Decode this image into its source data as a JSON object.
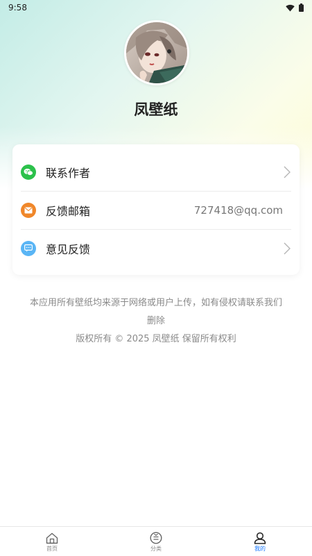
{
  "status_bar": {
    "time": "9:58"
  },
  "profile": {
    "app_name": "凤壁纸"
  },
  "menu": {
    "items": [
      {
        "label": "联系作者",
        "icon": "wechat-icon",
        "icon_color": "#2cc14b",
        "has_chevron": true
      },
      {
        "label": "反馈邮箱",
        "icon": "mail-icon",
        "icon_color": "#f0872a",
        "value": "727418@qq.com"
      },
      {
        "label": "意见反馈",
        "icon": "feedback-icon",
        "icon_color": "#5ab5f5",
        "has_chevron": true
      }
    ]
  },
  "footer": {
    "disclaimer_line1": "本应用所有壁纸均来源于网络或用户上传，如有侵权请联系我们",
    "disclaimer_line2": "删除",
    "copyright": "版权所有 © 2025 凤壁纸 保留所有权利"
  },
  "tabbar": {
    "tabs": [
      {
        "label": "首页",
        "icon": "home-icon",
        "active": false
      },
      {
        "label": "分类",
        "icon": "category-icon",
        "active": false
      },
      {
        "label": "我的",
        "icon": "profile-icon",
        "active": true
      }
    ],
    "active_color": "#1677ff"
  }
}
